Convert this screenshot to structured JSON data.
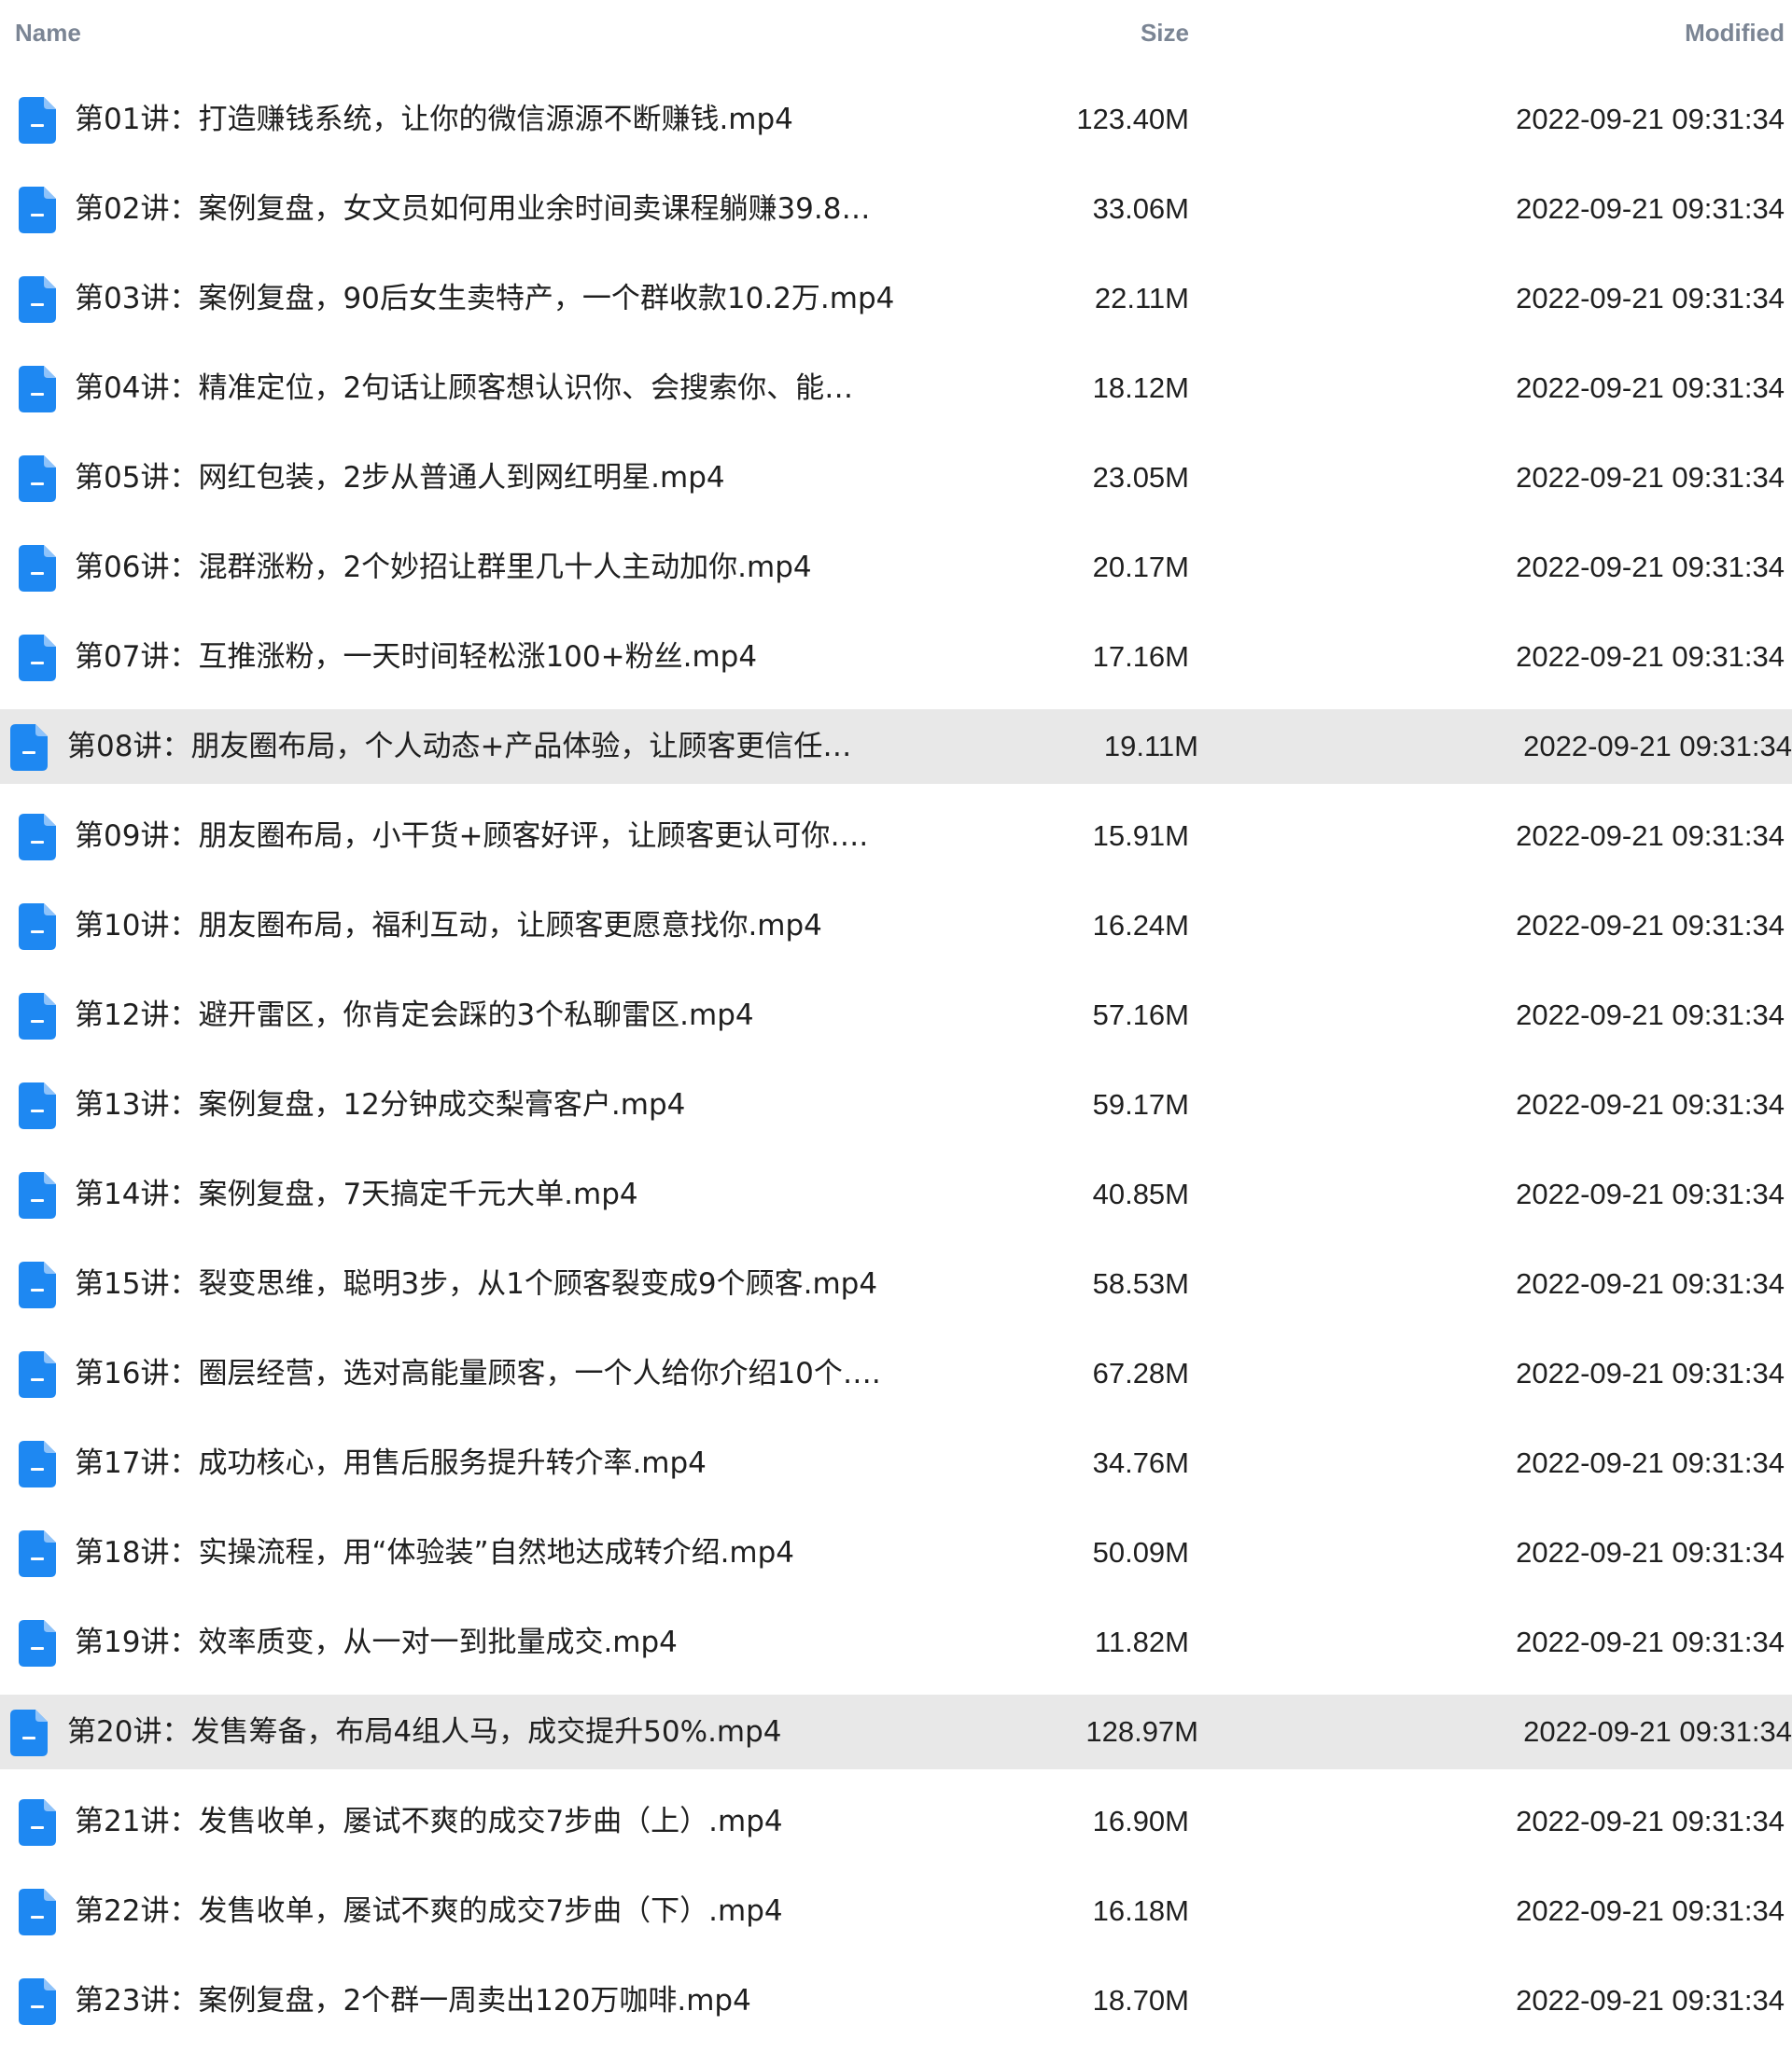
{
  "header": {
    "name": "Name",
    "size": "Size",
    "modified": "Modified"
  },
  "colors": {
    "file_icon": "#1e88f2",
    "selected_row": "#e8e8e8",
    "header_text": "#7b8594"
  },
  "icons": {
    "file": "document-icon"
  },
  "selected_rows": [
    7,
    18
  ],
  "files": [
    {
      "name": "第01讲：打造赚钱系统，让你的微信源源不断赚钱.mp4",
      "size": "123.40M",
      "modified": "2022-09-21 09:31:34"
    },
    {
      "name": "第02讲：案例复盘，女文员如何用业余时间卖课程躺赚39.8…",
      "size": "33.06M",
      "modified": "2022-09-21 09:31:34"
    },
    {
      "name": "第03讲：案例复盘，90后女生卖特产，一个群收款10.2万.mp4",
      "size": "22.11M",
      "modified": "2022-09-21 09:31:34"
    },
    {
      "name": "第04讲：精准定位，2句话让顾客想认识你、会搜索你、能…",
      "size": "18.12M",
      "modified": "2022-09-21 09:31:34"
    },
    {
      "name": "第05讲：网红包装，2步从普通人到网红明星.mp4",
      "size": "23.05M",
      "modified": "2022-09-21 09:31:34"
    },
    {
      "name": "第06讲：混群涨粉，2个妙招让群里几十人主动加你.mp4",
      "size": "20.17M",
      "modified": "2022-09-21 09:31:34"
    },
    {
      "name": "第07讲：互推涨粉，一天时间轻松涨100+粉丝.mp4",
      "size": "17.16M",
      "modified": "2022-09-21 09:31:34"
    },
    {
      "name": "第08讲：朋友圈布局，个人动态+产品体验，让顾客更信任…",
      "size": "19.11M",
      "modified": "2022-09-21 09:31:34"
    },
    {
      "name": "第09讲：朋友圈布局，小干货+顾客好评，让顾客更认可你….",
      "size": "15.91M",
      "modified": "2022-09-21 09:31:34"
    },
    {
      "name": "第10讲：朋友圈布局，福利互动，让顾客更愿意找你.mp4",
      "size": "16.24M",
      "modified": "2022-09-21 09:31:34"
    },
    {
      "name": "第12讲：避开雷区，你肯定会踩的3个私聊雷区.mp4",
      "size": "57.16M",
      "modified": "2022-09-21 09:31:34"
    },
    {
      "name": "第13讲：案例复盘，12分钟成交梨膏客户.mp4",
      "size": "59.17M",
      "modified": "2022-09-21 09:31:34"
    },
    {
      "name": "第14讲：案例复盘，7天搞定千元大单.mp4",
      "size": "40.85M",
      "modified": "2022-09-21 09:31:34"
    },
    {
      "name": "第15讲：裂变思维，聪明3步，从1个顾客裂变成9个顾客.mp4",
      "size": "58.53M",
      "modified": "2022-09-21 09:31:34"
    },
    {
      "name": "第16讲：圈层经营，选对高能量顾客，一个人给你介绍10个….",
      "size": "67.28M",
      "modified": "2022-09-21 09:31:34"
    },
    {
      "name": "第17讲：成功核心，用售后服务提升转介率.mp4",
      "size": "34.76M",
      "modified": "2022-09-21 09:31:34"
    },
    {
      "name": "第18讲：实操流程，用“体验装”自然地达成转介绍.mp4",
      "size": "50.09M",
      "modified": "2022-09-21 09:31:34"
    },
    {
      "name": "第19讲：效率质变，从一对一到批量成交.mp4",
      "size": "11.82M",
      "modified": "2022-09-21 09:31:34"
    },
    {
      "name": "第20讲：发售筹备，布局4组人马，成交提升50%.mp4",
      "size": "128.97M",
      "modified": "2022-09-21 09:31:34"
    },
    {
      "name": "第21讲：发售收单，屡试不爽的成交7步曲（上）.mp4",
      "size": "16.90M",
      "modified": "2022-09-21 09:31:34"
    },
    {
      "name": "第22讲：发售收单，屡试不爽的成交7步曲（下）.mp4",
      "size": "16.18M",
      "modified": "2022-09-21 09:31:34"
    },
    {
      "name": "第23讲：案例复盘，2个群一周卖出120万咖啡.mp4",
      "size": "18.70M",
      "modified": "2022-09-21 09:31:34"
    }
  ]
}
